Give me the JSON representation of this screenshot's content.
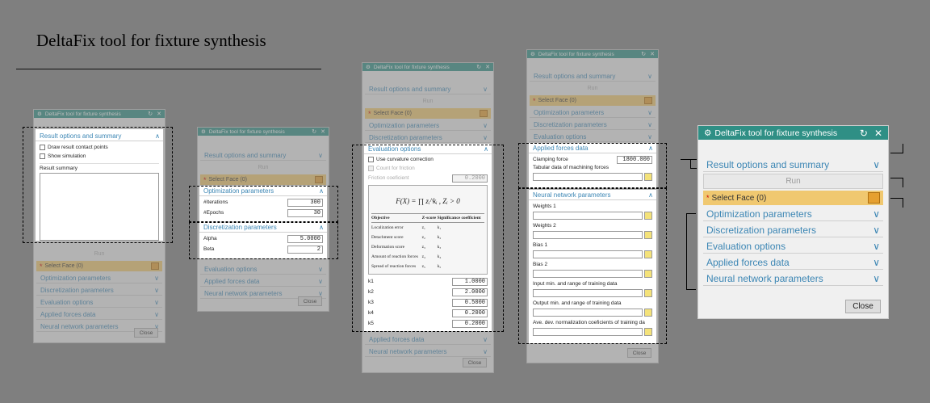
{
  "title": "DeltaFix tool for fixture synthesis",
  "dialog_title": "DeltaFix tool for fixture synthesis",
  "sections": {
    "result": "Result options and summary",
    "optimization": "Optimization parameters",
    "discretization": "Discretization parameters",
    "evaluation": "Evaluation options",
    "forces": "Applied forces data",
    "neural": "Neural network parameters"
  },
  "run_label": "Run",
  "select_face": "Select Face (0)",
  "close_label": "Close",
  "icons": {
    "settings": "gear-icon",
    "reset": "reset-icon",
    "close": "close-icon",
    "chevron": "chevron-down-icon"
  },
  "accent": "#2f8f85",
  "p1": {
    "draw_contacts": "Draw result contact points",
    "show_sim": "Show simulation",
    "summary_label": "Result summary"
  },
  "p2": {
    "iterations_label": "#Iterations",
    "iterations": "300",
    "epochs_label": "#Epochs",
    "epochs": "30",
    "alpha_label": "Alpha",
    "alpha": "5.0000",
    "beta_label": "Beta",
    "beta": "2"
  },
  "p3": {
    "curvature": "Use curvature correction",
    "count_friction": "Count for friction",
    "friction_label": "Friction coeficient",
    "friction": "0.2000",
    "equation": "F(X) = ∏ zᵢ^kᵢ , Zᵢ > 0",
    "table_headers": [
      "Objective",
      "Z-score",
      "Significance coefficient"
    ],
    "table_rows": [
      [
        "Localization error",
        "z₁",
        "k₁"
      ],
      [
        "Detachment score",
        "z₂",
        "k₂"
      ],
      [
        "Deformation score",
        "z₃",
        "k₃"
      ],
      [
        "Amount of reaction forces",
        "z₄",
        "k₄"
      ],
      [
        "Spread of reaction forces",
        "z₅",
        "k₅"
      ]
    ],
    "k": [
      {
        "label": "k1",
        "value": "1.0000"
      },
      {
        "label": "k2",
        "value": "2.0000"
      },
      {
        "label": "k3",
        "value": "0.5000"
      },
      {
        "label": "k4",
        "value": "0.2000"
      },
      {
        "label": "k5",
        "value": "0.2000"
      }
    ]
  },
  "p4": {
    "clamping_label": "Clamping force",
    "clamping": "1800.000",
    "tabular_label": "Tabular data of machining forces",
    "nn_fields": [
      "Weights 1",
      "Weights 2",
      "Bias 1",
      "Bias 2",
      "Input min. and range of training data",
      "Output min. and range of training data",
      "Ave. dev. normalization coeficients of training da"
    ]
  }
}
